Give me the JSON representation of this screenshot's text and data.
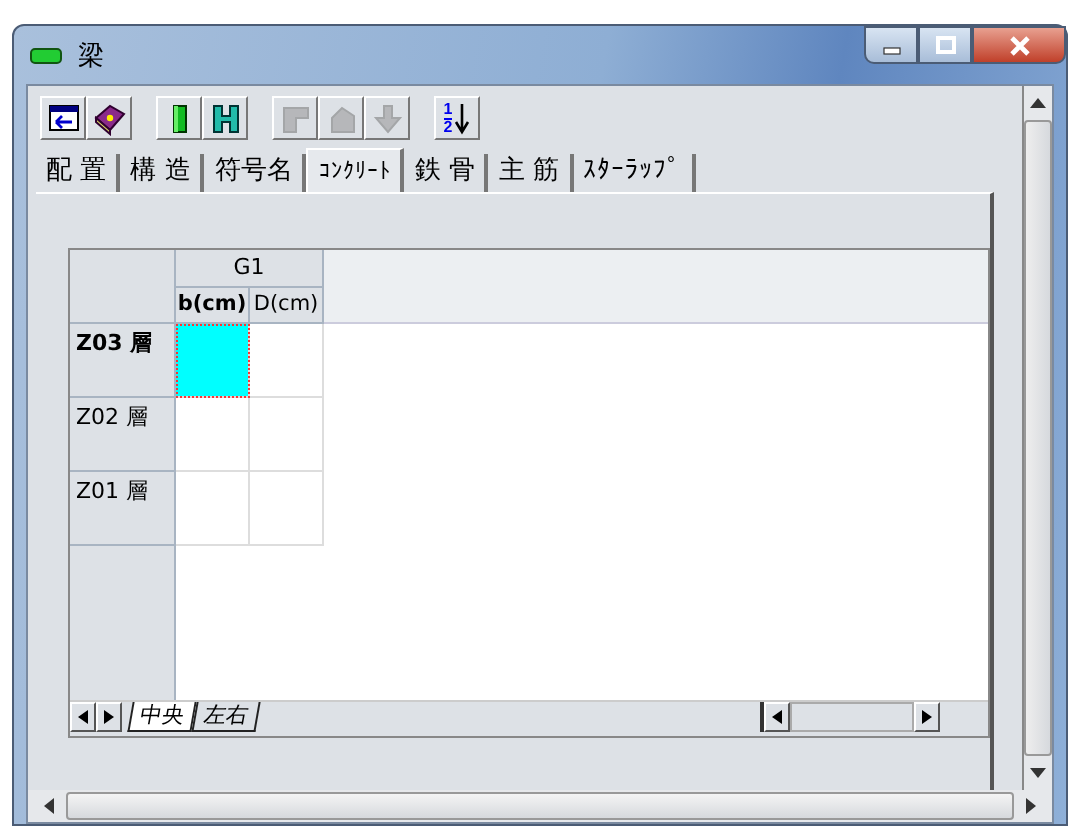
{
  "window": {
    "title": "梁"
  },
  "toolbar": [
    [
      {
        "disabled": false
      },
      {
        "disabled": false
      }
    ],
    [
      {
        "disabled": false
      },
      {
        "disabled": false
      }
    ],
    [
      {
        "disabled": true
      },
      {
        "disabled": true
      },
      {
        "disabled": true
      }
    ],
    [
      {
        "disabled": false,
        "digits": [
          "1",
          "2"
        ]
      }
    ]
  ],
  "tabs": [
    {
      "label": "配 置",
      "selected": false
    },
    {
      "label": "構 造",
      "selected": false
    },
    {
      "label": "符号名",
      "selected": false
    },
    {
      "label": "ｺﾝｸﾘｰﾄ",
      "selected": true
    },
    {
      "label": "鉄 骨",
      "selected": false
    },
    {
      "label": "主 筋",
      "selected": false
    },
    {
      "label": "ｽﾀｰﾗｯﾌﾟ",
      "selected": false
    }
  ],
  "grid": {
    "group_header": "G1",
    "columns": [
      {
        "label": "b(cm)",
        "selected": true
      },
      {
        "label": "D(cm)",
        "selected": false
      }
    ],
    "rows": [
      {
        "label": "Z03 層",
        "selected": true,
        "cells": [
          {
            "selected": true
          },
          {
            "selected": false
          }
        ]
      },
      {
        "label": "Z02 層",
        "selected": false,
        "cells": [
          {
            "selected": false
          },
          {
            "selected": false
          }
        ]
      },
      {
        "label": "Z01 層",
        "selected": false,
        "cells": [
          {
            "selected": false
          },
          {
            "selected": false
          }
        ]
      }
    ]
  },
  "sheet_tabs": [
    {
      "label": "中央",
      "selected": true
    },
    {
      "label": "左右",
      "selected": false
    }
  ]
}
